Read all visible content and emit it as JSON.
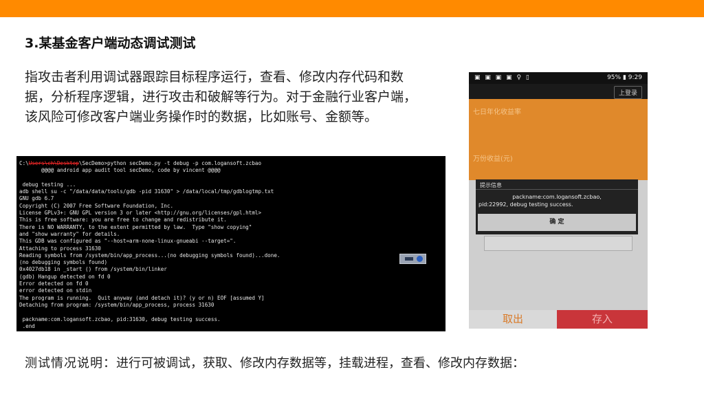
{
  "slide": {
    "title": "3.某基金客户端动态调试测试",
    "description": "指攻击者利用调试器跟踪目标程序运行，查看、修改内存代码和数据，分析程序逻辑，进行攻击和破解等行为。对于金融行业客户端，该风险可修改客户端业务操作时的数据，比如账号、金额等。",
    "footer_lead": "测试情况说明：",
    "footer_text": "进行可被调试，获取、修改内存数据等，挂载进程，查看、修改内存数据：",
    "accent_color": "#ff8a00"
  },
  "terminal": {
    "prompt_prefix": "C:\\",
    "redacted_path": "Users\\ch\\Desktop",
    "first_line_rest": "\\SecDemo>python secDemo.py -t debug -p com.logansoft.zcbao",
    "lines": [
      "       @@@@ android app audit tool secDemo, code by vincent @@@@",
      "",
      " debug testing ...",
      "adb shell su -c \"/data/data/tools/gdb -pid 31630\" > /data/local/tmp/gdblogtmp.txt",
      "GNU gdb 6.7",
      "Copyright (C) 2007 Free Software Foundation, Inc.",
      "License GPLv3+: GNU GPL version 3 or later <http://gnu.org/licenses/gpl.html>",
      "This is free software: you are free to change and redistribute it.",
      "There is NO WARRANTY, to the extent permitted by law.  Type \"show copying\"",
      "and \"show warranty\" for details.",
      "This GDB was configured as \"--host=arm-none-linux-gnueabi --target=\".",
      "Attaching to process 31630",
      "Reading symbols from /system/bin/app_process...(no debugging symbols found)...done.",
      "(no debugging symbols found)",
      "0x4027db18 in _start () from /system/bin/linker",
      "(gdb) Hangup detected on fd 0",
      "Error detected on fd 0",
      "error detected on stdin",
      "The program is running.  Quit anyway (and detach it)? (y or n) EOF [assumed Y]",
      "Detaching from program: /system/bin/app_process, process 31630",
      "",
      " packname:com.logansoft.zcbao, pid:31630, debug testing success.",
      " .end"
    ]
  },
  "phone": {
    "status_time": "9:29",
    "status_battery": "95%",
    "login_label": "上登录",
    "label_yield": "七日年化收益率",
    "label_income": "万份收益(元)",
    "dialog_title": "提示信息",
    "dialog_line1": "packname:com.logansoft.zcbao,",
    "dialog_line2": "pid:22992, debug testing success.",
    "dialog_ok": "确 定",
    "btn_cancel": "取出",
    "btn_deposit": "存入"
  }
}
